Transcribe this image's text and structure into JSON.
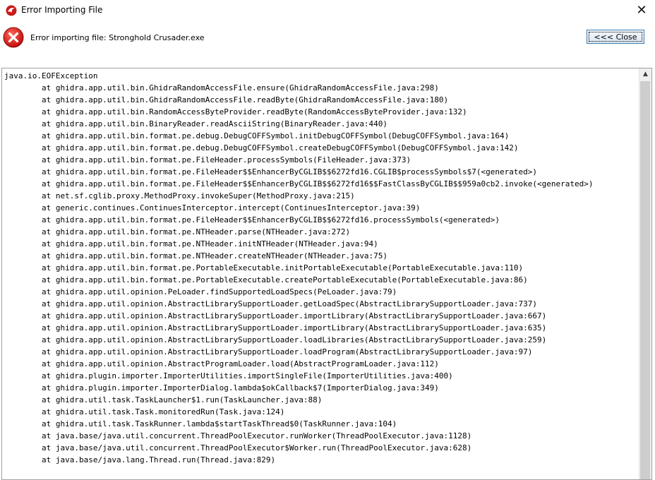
{
  "window": {
    "title": "Error Importing File",
    "icon": "ghidra-dragon-icon",
    "close_glyph": "✕"
  },
  "header": {
    "message": "Error importing file: Stronghold Crusader.exe",
    "close_label": "<<< Close",
    "error_icon": "error-x-icon"
  },
  "trace": {
    "lines": [
      "java.io.EOFException",
      "\tat ghidra.app.util.bin.GhidraRandomAccessFile.ensure(GhidraRandomAccessFile.java:298)",
      "\tat ghidra.app.util.bin.GhidraRandomAccessFile.readByte(GhidraRandomAccessFile.java:180)",
      "\tat ghidra.app.util.bin.RandomAccessByteProvider.readByte(RandomAccessByteProvider.java:132)",
      "\tat ghidra.app.util.bin.BinaryReader.readAsciiString(BinaryReader.java:440)",
      "\tat ghidra.app.util.bin.format.pe.debug.DebugCOFFSymbol.initDebugCOFFSymbol(DebugCOFFSymbol.java:164)",
      "\tat ghidra.app.util.bin.format.pe.debug.DebugCOFFSymbol.createDebugCOFFSymbol(DebugCOFFSymbol.java:142)",
      "\tat ghidra.app.util.bin.format.pe.FileHeader.processSymbols(FileHeader.java:373)",
      "\tat ghidra.app.util.bin.format.pe.FileHeader$$EnhancerByCGLIB$$6272fd16.CGLIB$processSymbols$7(<generated>)",
      "\tat ghidra.app.util.bin.format.pe.FileHeader$$EnhancerByCGLIB$$6272fd16$$FastClassByCGLIB$$959a0cb2.invoke(<generated>)",
      "\tat net.sf.cglib.proxy.MethodProxy.invokeSuper(MethodProxy.java:215)",
      "\tat generic.continues.ContinuesInterceptor.intercept(ContinuesInterceptor.java:39)",
      "\tat ghidra.app.util.bin.format.pe.FileHeader$$EnhancerByCGLIB$$6272fd16.processSymbols(<generated>)",
      "\tat ghidra.app.util.bin.format.pe.NTHeader.parse(NTHeader.java:272)",
      "\tat ghidra.app.util.bin.format.pe.NTHeader.initNTHeader(NTHeader.java:94)",
      "\tat ghidra.app.util.bin.format.pe.NTHeader.createNTHeader(NTHeader.java:75)",
      "\tat ghidra.app.util.bin.format.pe.PortableExecutable.initPortableExecutable(PortableExecutable.java:110)",
      "\tat ghidra.app.util.bin.format.pe.PortableExecutable.createPortableExecutable(PortableExecutable.java:86)",
      "\tat ghidra.app.util.opinion.PeLoader.findSupportedLoadSpecs(PeLoader.java:79)",
      "\tat ghidra.app.util.opinion.AbstractLibrarySupportLoader.getLoadSpec(AbstractLibrarySupportLoader.java:737)",
      "\tat ghidra.app.util.opinion.AbstractLibrarySupportLoader.importLibrary(AbstractLibrarySupportLoader.java:667)",
      "\tat ghidra.app.util.opinion.AbstractLibrarySupportLoader.importLibrary(AbstractLibrarySupportLoader.java:635)",
      "\tat ghidra.app.util.opinion.AbstractLibrarySupportLoader.loadLibraries(AbstractLibrarySupportLoader.java:259)",
      "\tat ghidra.app.util.opinion.AbstractLibrarySupportLoader.loadProgram(AbstractLibrarySupportLoader.java:97)",
      "\tat ghidra.app.util.opinion.AbstractProgramLoader.load(AbstractProgramLoader.java:112)",
      "\tat ghidra.plugin.importer.ImporterUtilities.importSingleFile(ImporterUtilities.java:400)",
      "\tat ghidra.plugin.importer.ImporterDialog.lambda$okCallback$7(ImporterDialog.java:349)",
      "\tat ghidra.util.task.TaskLauncher$1.run(TaskLauncher.java:88)",
      "\tat ghidra.util.task.Task.monitoredRun(Task.java:124)",
      "\tat ghidra.util.task.TaskRunner.lambda$startTaskThread$0(TaskRunner.java:104)",
      "\tat java.base/java.util.concurrent.ThreadPoolExecutor.runWorker(ThreadPoolExecutor.java:1128)",
      "\tat java.base/java.util.concurrent.ThreadPoolExecutor$Worker.run(ThreadPoolExecutor.java:628)",
      "\tat java.base/java.lang.Thread.run(Thread.java:829)"
    ]
  },
  "colors": {
    "error_red": "#e81123",
    "button_border": "#3c7fb1"
  }
}
